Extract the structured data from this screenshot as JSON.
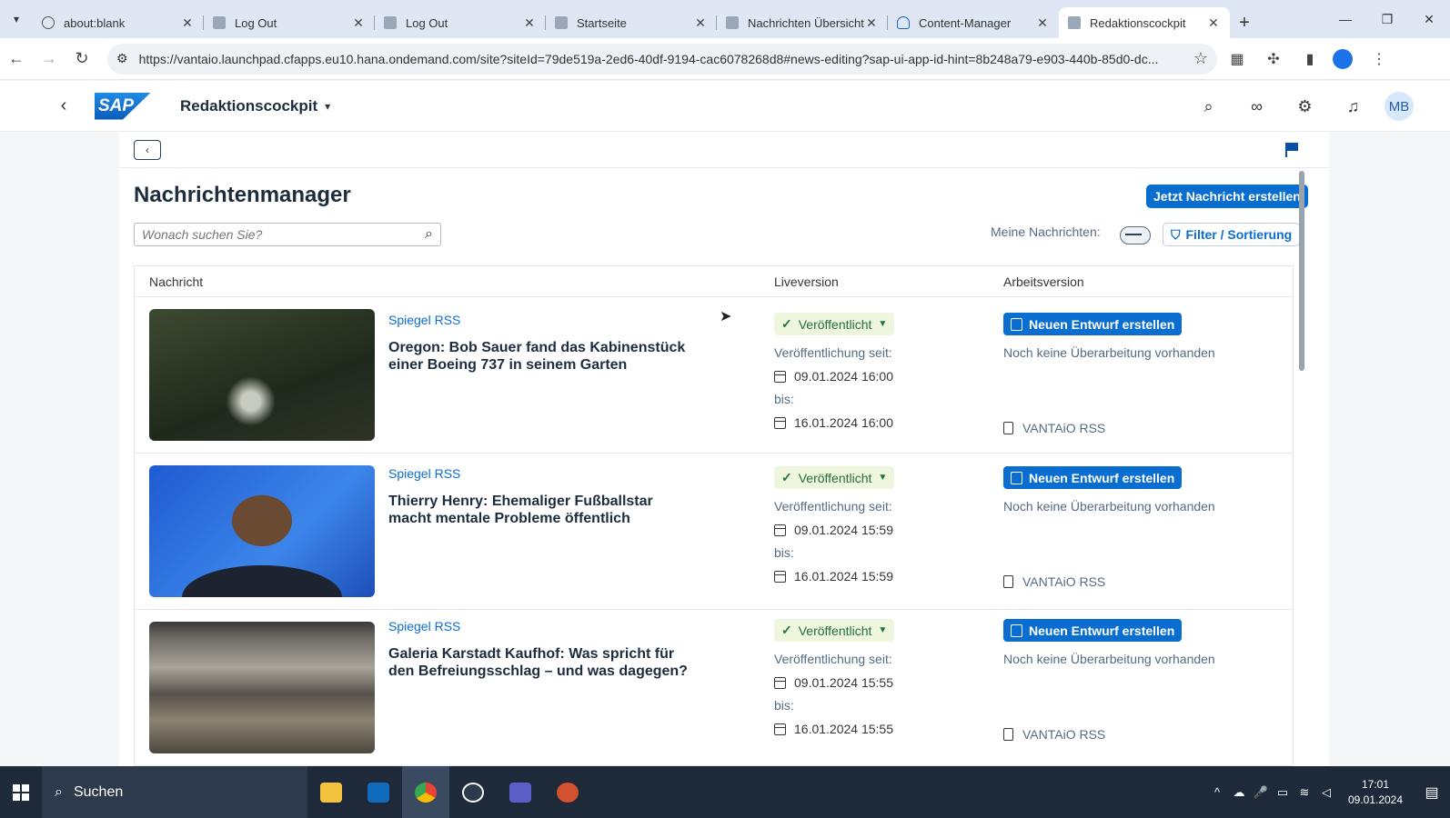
{
  "browser": {
    "tabs": [
      {
        "title": "about:blank",
        "icon": "globe-icon"
      },
      {
        "title": "Log Out",
        "icon": "page-icon"
      },
      {
        "title": "Log Out",
        "icon": "page-icon"
      },
      {
        "title": "Startseite",
        "icon": "page-icon"
      },
      {
        "title": "Nachrichten Übersicht",
        "icon": "page-icon"
      },
      {
        "title": "Content-Manager",
        "icon": "cloud-icon"
      },
      {
        "title": "Redaktionscockpit",
        "icon": "page-icon",
        "active": true
      }
    ],
    "url": "https://vantaio.launchpad.cfapps.eu10.hana.ondemand.com/site?siteId=79de519a-2ed6-40df-9194-cac6078268d8#news-editing?sap-ui-app-id-hint=8b248a79-e903-440b-85d0-dc..."
  },
  "shell": {
    "logo": "SAP",
    "app_title": "Redaktionscockpit",
    "user_initials": "MB"
  },
  "page": {
    "title": "Nachrichtenmanager",
    "create_button": "Jetzt Nachricht erstellen",
    "search_placeholder": "Wonach suchen Sie?",
    "my_news_label": "Meine Nachrichten:",
    "filter_button": "Filter / Sortierung"
  },
  "table": {
    "columns": [
      "Nachricht",
      "Liveversion",
      "Arbeitsversion"
    ],
    "rows": [
      {
        "source": "Spiegel RSS",
        "headline": "Oregon: Bob Sauer fand das Kabinenstück einer Boeing 737 in seinem Garten",
        "status": "Veröffentlicht",
        "since_label": "Veröffentlichung seit:",
        "since": "09.01.2024 16:00",
        "until_label": "bis:",
        "until": "16.01.2024 16:00",
        "draft_button": "Neuen Entwurf erstellen",
        "no_revision": "Noch keine Überarbeitung vorhanden",
        "owner": "VANTAiO RSS"
      },
      {
        "source": "Spiegel RSS",
        "headline": "Thierry Henry: Ehemaliger Fußballstar macht mentale Probleme öffentlich",
        "status": "Veröffentlicht",
        "since_label": "Veröffentlichung seit:",
        "since": "09.01.2024 15:59",
        "until_label": "bis:",
        "until": "16.01.2024 15:59",
        "draft_button": "Neuen Entwurf erstellen",
        "no_revision": "Noch keine Überarbeitung vorhanden",
        "owner": "VANTAiO RSS"
      },
      {
        "source": "Spiegel RSS",
        "headline": "Galeria Karstadt Kaufhof: Was spricht für den Befreiungsschlag – und was dagegen?",
        "status": "Veröffentlicht",
        "since_label": "Veröffentlichung seit:",
        "since": "09.01.2024 15:55",
        "until_label": "bis:",
        "until": "16.01.2024 15:55",
        "draft_button": "Neuen Entwurf erstellen",
        "no_revision": "Noch keine Überarbeitung vorhanden",
        "owner": "VANTAiO RSS"
      }
    ]
  },
  "taskbar": {
    "search_label": "Suchen",
    "time": "17:01",
    "date": "09.01.2024"
  },
  "colors": {
    "accent": "#0a6ed1",
    "status_positive_bg": "#eef7dd",
    "status_positive_text": "#256f3a"
  }
}
